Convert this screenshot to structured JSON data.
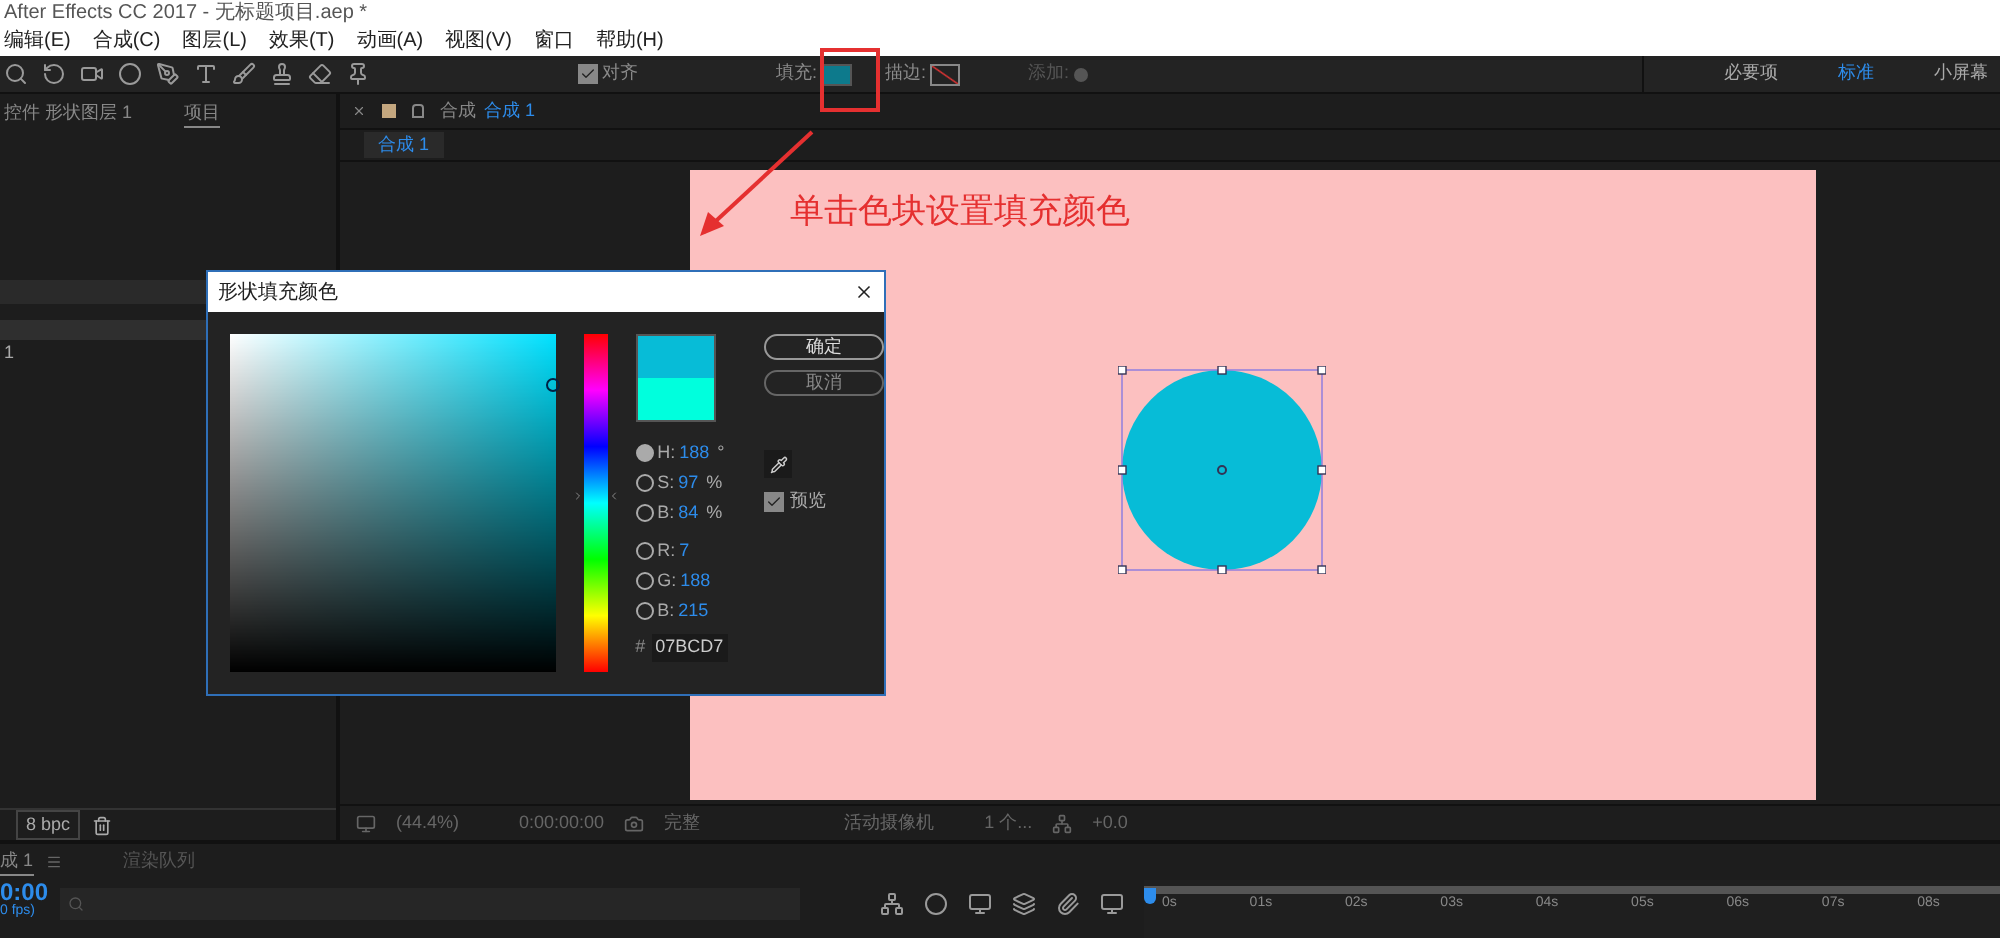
{
  "window": {
    "title": "After Effects CC 2017 - 无标题项目.aep *"
  },
  "menu": [
    "编辑(E)",
    "合成(C)",
    "图层(L)",
    "效果(T)",
    "动画(A)",
    "视图(V)",
    "窗口",
    "帮助(H)"
  ],
  "toolbar": {
    "snap": {
      "label": "对齐",
      "checked": true
    },
    "fill_label": "填充:",
    "stroke_label": "描边:",
    "add_label": "添加:",
    "workspaces": [
      {
        "label": "必要项",
        "selected": false
      },
      {
        "label": "标准",
        "selected": true
      },
      {
        "label": "小屏幕",
        "selected": false
      }
    ]
  },
  "left_panel": {
    "tabs": [
      {
        "label": "控件 形状图层 1",
        "selected": false
      },
      {
        "label": "项目",
        "selected": true
      }
    ],
    "row": "1",
    "bpc": "8 bpc"
  },
  "composition": {
    "tab_prefix": "合成",
    "tab_name": "合成 1",
    "subtab": "合成 1",
    "bar": {
      "zoom": "(44.4%)",
      "time": "0:00:00:00",
      "resolution": "完整",
      "camera": "活动摄像机",
      "views": "1 个...",
      "exposure": "+0.0"
    }
  },
  "annotation": {
    "text": "单击色块设置填充颜色"
  },
  "dialog": {
    "title": "形状填充颜色",
    "hue": {
      "level": 0.48
    },
    "swatches": [
      {
        "color": "#07bcd7"
      },
      {
        "color": "#00ffdd"
      }
    ],
    "hsb": [
      {
        "label": "H:",
        "value": "188",
        "unit": "°",
        "selected": true
      },
      {
        "label": "S:",
        "value": "97",
        "unit": "%",
        "selected": false
      },
      {
        "label": "B:",
        "value": "84",
        "unit": "%",
        "selected": false
      }
    ],
    "rgb": [
      {
        "label": "R:",
        "value": "7",
        "selected": false
      },
      {
        "label": "G:",
        "value": "188",
        "selected": false
      },
      {
        "label": "B:",
        "value": "215",
        "selected": false
      }
    ],
    "hex": {
      "label": "#",
      "value": "07BCD7"
    },
    "ok": "确定",
    "cancel": "取消",
    "preview": {
      "label": "预览",
      "checked": true
    }
  },
  "timeline": {
    "tabs": [
      {
        "label": "成 1",
        "selected": true
      },
      {
        "label": "渲染队列",
        "selected": false
      }
    ],
    "time": "0:00",
    "fps": "0 fps)",
    "ruler": [
      "0s",
      "01s",
      "02s",
      "03s",
      "04s",
      "05s",
      "06s",
      "07s",
      "08s"
    ]
  }
}
